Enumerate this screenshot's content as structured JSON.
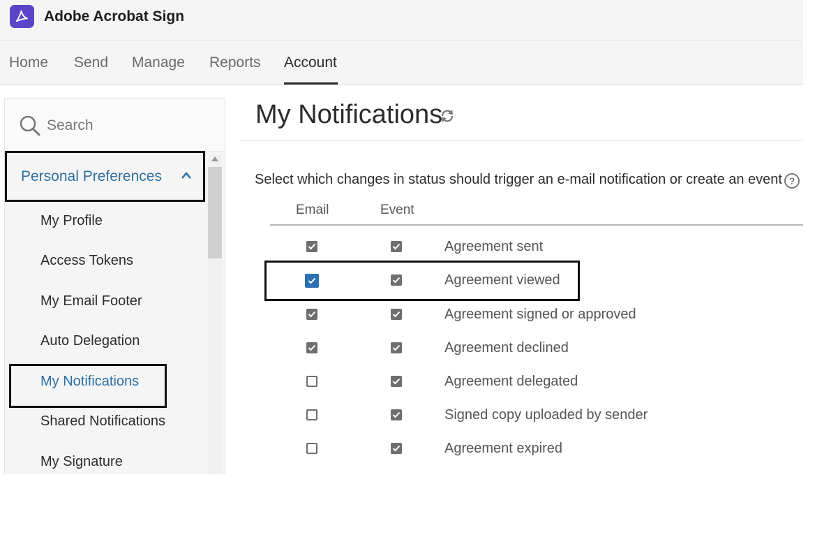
{
  "app": {
    "title": "Adobe Acrobat Sign",
    "brand_color": "#5c44c9"
  },
  "nav": {
    "items": [
      {
        "label": "Home"
      },
      {
        "label": "Send"
      },
      {
        "label": "Manage"
      },
      {
        "label": "Reports"
      },
      {
        "label": "Account",
        "active": true
      }
    ]
  },
  "sidebar": {
    "search_label": "Search",
    "section_label": "Personal Preferences",
    "items": [
      {
        "label": "My Profile"
      },
      {
        "label": "Access Tokens"
      },
      {
        "label": "My Email Footer"
      },
      {
        "label": "Auto Delegation"
      },
      {
        "label": "My Notifications",
        "active": true
      },
      {
        "label": "Shared Notifications"
      },
      {
        "label": "My Signature"
      }
    ]
  },
  "main": {
    "title": "My Notifications",
    "instruction": "Select which changes in status should trigger an e-mail notification or create an event",
    "columns": {
      "email": "Email",
      "event": "Event"
    },
    "rows": [
      {
        "label": "Agreement sent",
        "email": true,
        "event": true
      },
      {
        "label": "Agreement viewed",
        "email": true,
        "event": true,
        "email_focused": true
      },
      {
        "label": "Agreement signed or approved",
        "email": true,
        "event": true
      },
      {
        "label": "Agreement declined",
        "email": true,
        "event": true
      },
      {
        "label": "Agreement delegated",
        "email": false,
        "event": true
      },
      {
        "label": "Signed copy uploaded by sender",
        "email": false,
        "event": true
      },
      {
        "label": "Agreement expired",
        "email": false,
        "event": true
      }
    ]
  },
  "colors": {
    "link": "#2d6fa3",
    "checkbox_checked": "#6e6e6e",
    "checkbox_focused": "#2d6fb0"
  }
}
